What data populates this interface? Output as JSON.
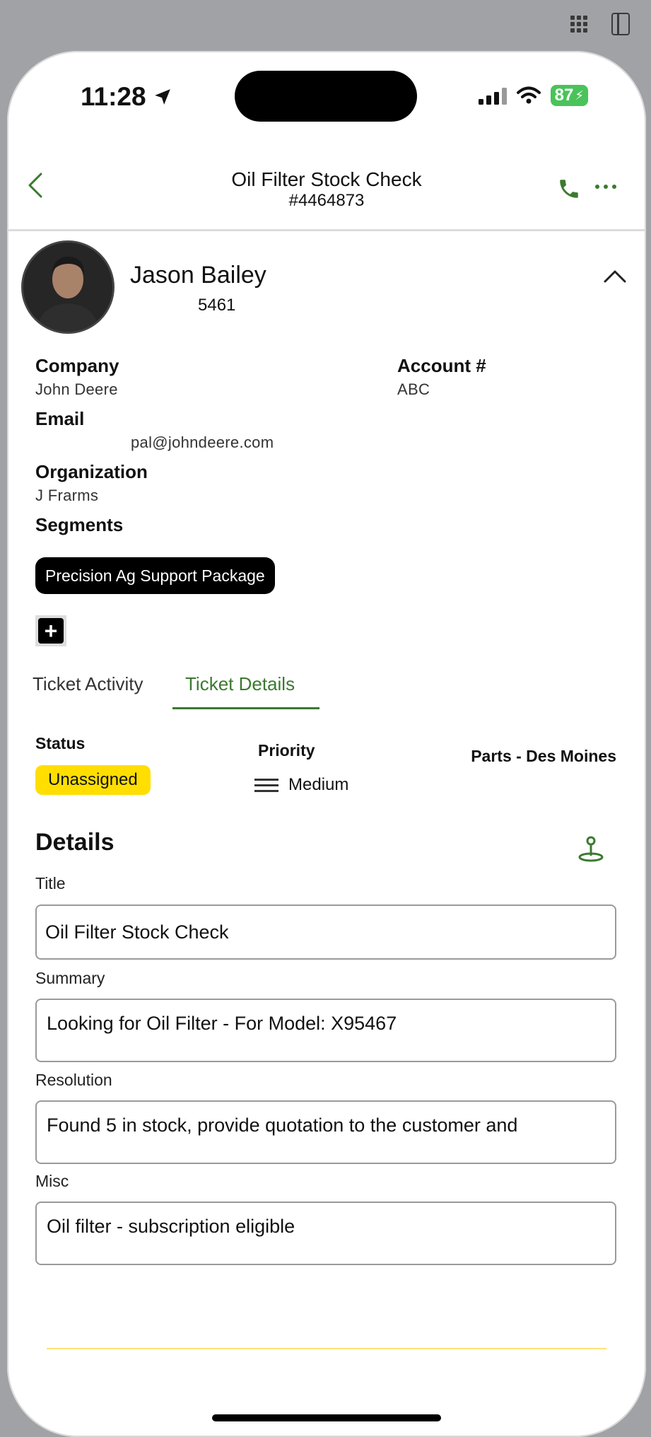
{
  "status_bar": {
    "time": "11:28",
    "battery": "87"
  },
  "nav": {
    "title": "Oil Filter Stock Check",
    "ticket_number": "#4464873"
  },
  "contact": {
    "name": "Jason Bailey",
    "phone_suffix": "5461",
    "company_label": "Company",
    "company": "John Deere",
    "account_label": "Account #",
    "account": "ABC",
    "email_label": "Email",
    "email": "pal@johndeere.com",
    "organization_label": "Organization",
    "organization": "J Frarms",
    "segments_label": "Segments",
    "segments": [
      "Precision Ag Support Package"
    ],
    "add_segment": "+"
  },
  "tabs": [
    {
      "label": "Ticket Activity",
      "active": false
    },
    {
      "label": "Ticket Details",
      "active": true
    }
  ],
  "ticket": {
    "status_label": "Status",
    "status": "Unassigned",
    "priority_label": "Priority",
    "priority": "Medium",
    "queue": "Parts - Des Moines"
  },
  "details": {
    "heading": "Details",
    "title_label": "Title",
    "title": "Oil Filter Stock Check",
    "summary_label": "Summary",
    "summary": "Looking for Oil Filter - For Model: X95467",
    "resolution_label": "Resolution",
    "resolution": "Found 5 in stock, provide quotation to the customer and",
    "misc_label": "Misc",
    "misc": "Oil filter - subscription eligible"
  },
  "colors": {
    "accent_green": "#3b7a2f",
    "status_yellow": "#ffde00",
    "battery_green": "#49c35a"
  },
  "icons": [
    "apps-grid-icon",
    "side-panel-icon",
    "location-arrow-icon",
    "signal-icon",
    "wifi-icon",
    "battery-icon",
    "back-chevron-icon",
    "phone-icon",
    "more-icon",
    "collapse-chevron-icon",
    "plus-icon",
    "priority-lines-icon",
    "map-pin-icon"
  ]
}
